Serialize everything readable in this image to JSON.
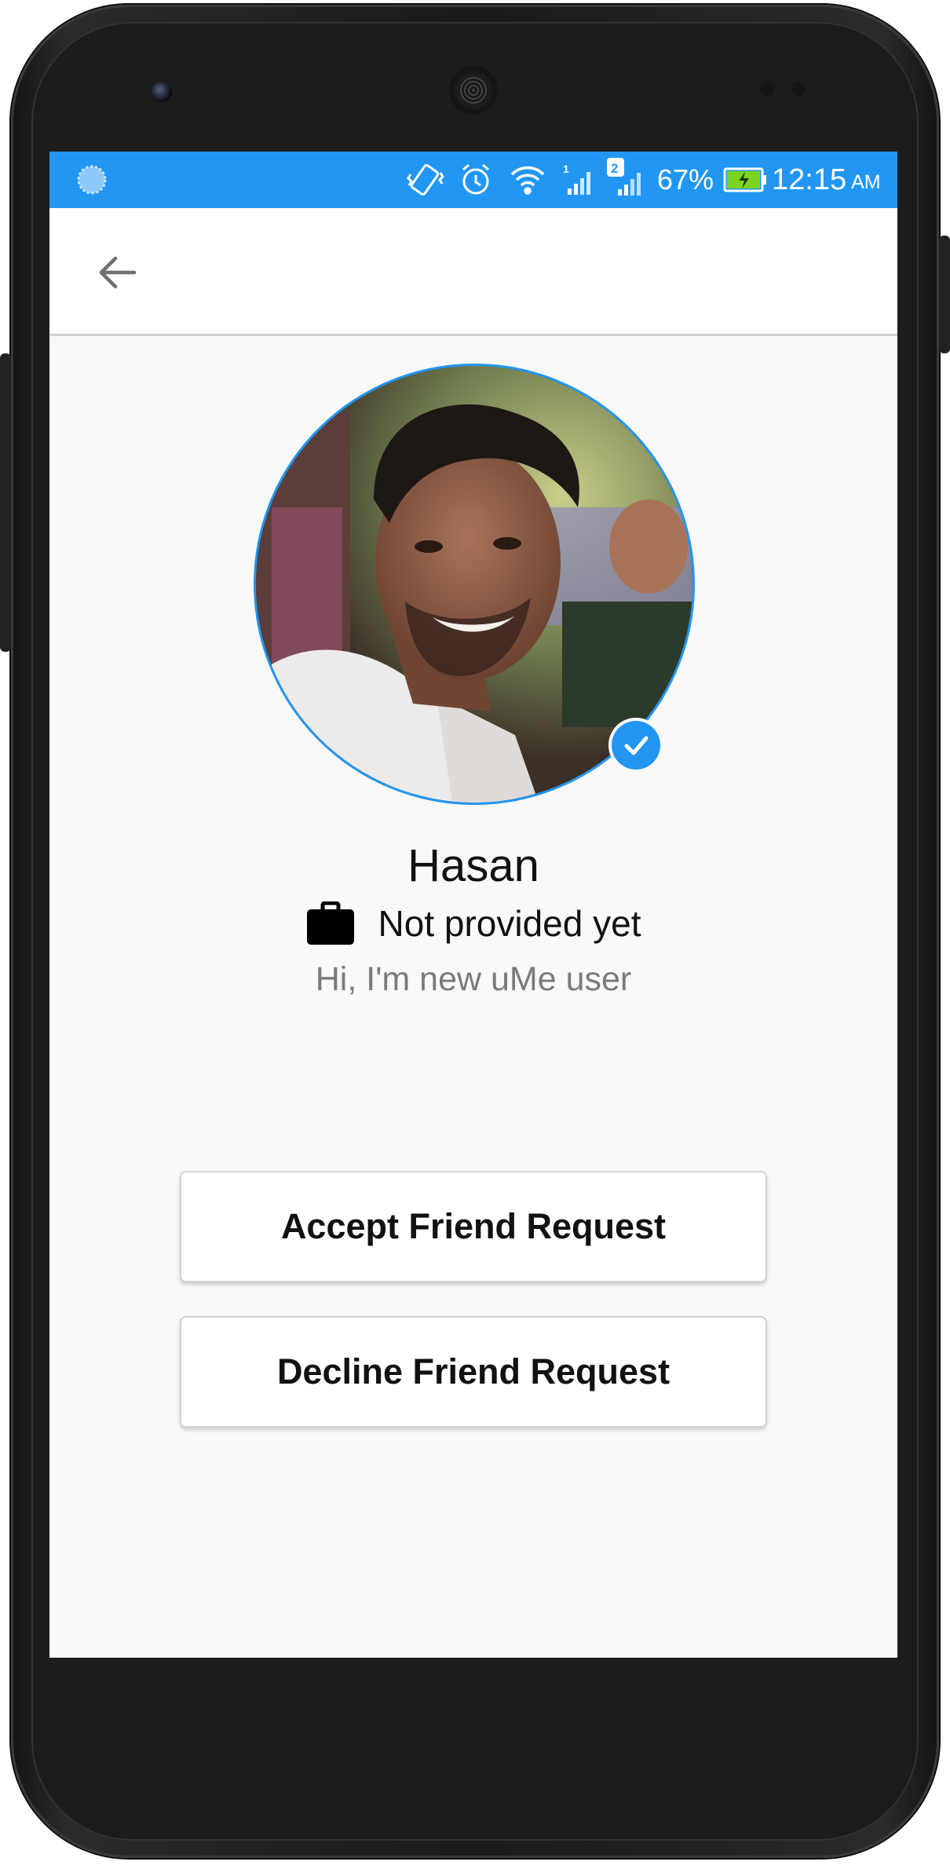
{
  "status_bar": {
    "battery_percent": "67%",
    "time": "12:15",
    "time_suffix": "AM",
    "sim1_label": "1",
    "sim2_label": "2",
    "colors": {
      "background": "#2196f3"
    }
  },
  "app_bar": {
    "back_icon": "arrow-back-icon"
  },
  "profile": {
    "name": "Hasan",
    "job": "Not provided yet",
    "bio": "Hi, I'm new uMe user",
    "verified_icon": "check-circle-icon",
    "job_icon": "briefcase-icon"
  },
  "actions": {
    "accept_label": "Accept Friend Request",
    "decline_label": "Decline Friend Request"
  },
  "colors": {
    "accent": "#2196f3",
    "screen_background": "#f9f9f9",
    "secondary_text": "#7a7a7a"
  }
}
